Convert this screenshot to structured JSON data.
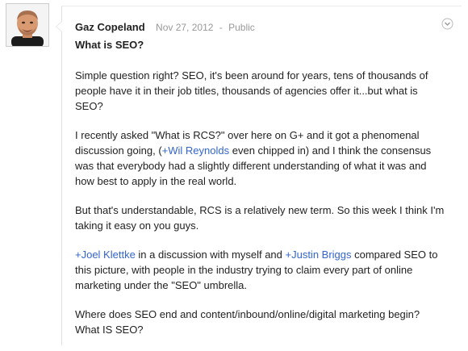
{
  "post": {
    "author": "Gaz Copeland",
    "date": "Nov 27, 2012",
    "separator": "-",
    "visibility": "Public",
    "title": "What is SEO?",
    "p1": "Simple question right? SEO, it's been around for years, tens of thousands of people have it in their job titles, thousands of agencies offer it...but what is SEO?",
    "p2_a": "I recently asked \"What is RCS?\" over here on G+ and it got a phenomenal discussion going, (",
    "p2_mention_plus": "+",
    "p2_mention": "Wil Reynolds",
    "p2_b": " even chipped in) and I think the consensus was that everybody had a  slightly different understanding of what it was and how best to apply in the real world.",
    "p3": "But that's understandable, RCS is a relatively new term. So this week I think I'm taking it easy on you guys.",
    "p4_mention1_plus": "+",
    "p4_mention1": "Joel Klettke",
    "p4_a": " in a discussion with myself and ",
    "p4_mention2_plus": "+",
    "p4_mention2": "Justin Briggs",
    "p4_b": " compared SEO to this picture, with people in the industry trying to claim every part of online marketing under the \"SEO\" umbrella.",
    "p5": "Where does SEO end and content/inbound/online/digital marketing begin? What IS SEO?"
  },
  "icons": {
    "avatar": "profile-photo",
    "menu": "chevron-down-circle-icon"
  },
  "colors": {
    "mention": "#3366cc",
    "text": "#222222",
    "meta": "#999999"
  }
}
